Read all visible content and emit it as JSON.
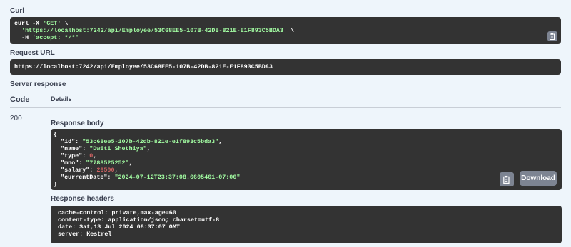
{
  "curl": {
    "label": "Curl",
    "cmd": "curl -X ",
    "method": "'GET'",
    "cont": " \\",
    "url": "'https://localhost:7242/api/Employee/53C68EE5-107B-42DB-821E-E1F893C5BDA3'",
    "h_flag": "-H ",
    "header": "'accept: */*'"
  },
  "request_url": {
    "label": "Request URL",
    "value": "https://localhost:7242/api/Employee/53C68EE5-107B-42DB-821E-E1F893C5BDA3"
  },
  "server_response": {
    "label": "Server response",
    "code_header": "Code",
    "details_header": "Details",
    "code": "200"
  },
  "response_body": {
    "label": "Response body",
    "open": "{",
    "close": "}",
    "fields": [
      {
        "key": "\"id\"",
        "value": "\"53c68ee5-107b-42db-821e-e1f893c5bda3\"",
        "type": "string",
        "comma": ","
      },
      {
        "key": "\"name\"",
        "value": "\"Dwiti Shethiya\"",
        "type": "string",
        "comma": ","
      },
      {
        "key": "\"type\"",
        "value": "0",
        "type": "number",
        "comma": ","
      },
      {
        "key": "\"mno\"",
        "value": "\"7788525252\"",
        "type": "string",
        "comma": ","
      },
      {
        "key": "\"salary\"",
        "value": "26500",
        "type": "number",
        "comma": ","
      },
      {
        "key": "\"currentDate\"",
        "value": "\"2024-07-12T23:37:08.6605461-07:00\"",
        "type": "string",
        "comma": ""
      }
    ],
    "download_label": "Download"
  },
  "response_headers": {
    "label": "Response headers",
    "lines": [
      "cache-control: private,max-age=60",
      "content-type: application/json; charset=utf-8",
      "date: Sat,13 Jul 2024 06:37:07 GMT",
      "server: Kestrel"
    ]
  },
  "icons": {
    "copy": "clipboard-icon"
  },
  "colors": {
    "background": "#eef5fb",
    "code_block": "#333333",
    "string": "#a2fca2",
    "number": "#d36363",
    "button": "#7d8492"
  }
}
